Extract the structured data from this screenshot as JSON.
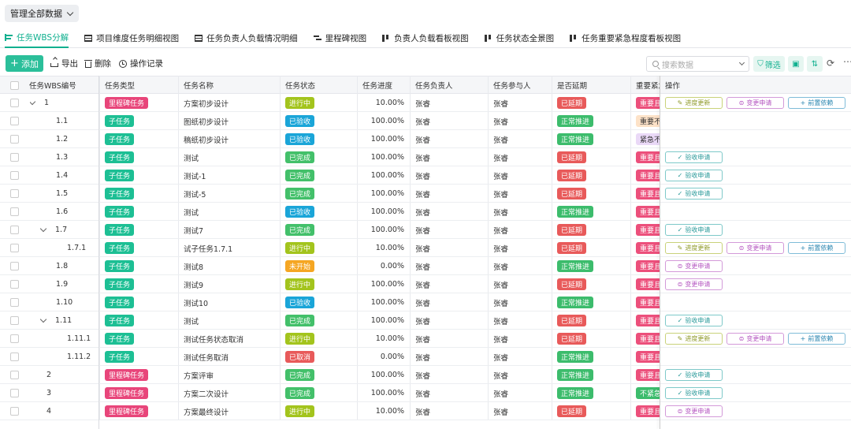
{
  "top_filter": {
    "label": "管理全部数据"
  },
  "tabs": [
    {
      "label": "任务WBS分解",
      "icon": "tree-icon",
      "active": true
    },
    {
      "label": "项目维度任务明细视图",
      "icon": "table-icon"
    },
    {
      "label": "任务负责人负载情况明细",
      "icon": "table-icon"
    },
    {
      "label": "里程碑视图",
      "icon": "gantt-icon"
    },
    {
      "label": "负责人负载看板视图",
      "icon": "kanban-icon"
    },
    {
      "label": "任务状态全景图",
      "icon": "kanban-icon"
    },
    {
      "label": "任务重要紧急程度看板视图",
      "icon": "kanban-icon"
    }
  ],
  "toolbar": {
    "add": "添加",
    "export": "导出",
    "delete": "删除",
    "log": "操作记录",
    "search_placeholder": "搜索数据",
    "filter": "筛选"
  },
  "columns": [
    "任务WBS编号",
    "任务类型",
    "任务名称",
    "任务状态",
    "任务进度",
    "任务负责人",
    "任务参与人",
    "是否延期",
    "重要紧急",
    "操作"
  ],
  "colors": {
    "accent": "#10b08f",
    "milestone": "#e8457a",
    "subtask": "#1dbf94",
    "accepted": "#1aa5d8",
    "in_progress": "#a3c41d",
    "done": "#43c06a",
    "not_started": "#f5a623",
    "cancelled": "#e85a5a",
    "delayed": "#e85a5a",
    "normal": "#3cbc6c",
    "important_urgent": "#ec4f7b"
  },
  "actions": {
    "progress": "进度更新",
    "change": "变更申请",
    "pre": "前置依赖",
    "accept": "验收申请"
  },
  "rows": [
    {
      "wbs": "1",
      "level": 0,
      "expand": true,
      "type": "里程碑任务",
      "name": "方案初步设计",
      "status": "进行中",
      "progress": "10.00%",
      "owner": "张睿",
      "participant": "张睿",
      "delay": "已延期",
      "priority": "重要且",
      "ops": [
        "progress",
        "change",
        "pre"
      ]
    },
    {
      "wbs": "1.1",
      "level": 1,
      "type": "子任务",
      "name": "图纸初步设计",
      "status": "已验收",
      "progress": "100.00%",
      "owner": "张睿",
      "participant": "张睿",
      "delay": "正常推进",
      "priority": "重要不",
      "ops": []
    },
    {
      "wbs": "1.2",
      "level": 1,
      "type": "子任务",
      "name": "稿纸初步设计",
      "status": "已验收",
      "progress": "100.00%",
      "owner": "张睿",
      "participant": "张睿",
      "delay": "正常推进",
      "priority": "紧急不",
      "ops": []
    },
    {
      "wbs": "1.3",
      "level": 1,
      "type": "子任务",
      "name": "测试",
      "status": "已完成",
      "progress": "100.00%",
      "owner": "张睿",
      "participant": "张睿",
      "delay": "已延期",
      "priority": "重要且",
      "ops": [
        "accept"
      ]
    },
    {
      "wbs": "1.4",
      "level": 1,
      "type": "子任务",
      "name": "测试-1",
      "status": "已完成",
      "progress": "100.00%",
      "owner": "张睿",
      "participant": "张睿",
      "delay": "已延期",
      "priority": "重要且",
      "ops": [
        "accept"
      ]
    },
    {
      "wbs": "1.5",
      "level": 1,
      "type": "子任务",
      "name": "测试-5",
      "status": "已完成",
      "progress": "100.00%",
      "owner": "张睿",
      "participant": "张睿",
      "delay": "已延期",
      "priority": "重要且",
      "ops": [
        "accept"
      ]
    },
    {
      "wbs": "1.6",
      "level": 1,
      "type": "子任务",
      "name": "测试",
      "status": "已验收",
      "progress": "100.00%",
      "owner": "张睿",
      "participant": "张睿",
      "delay": "正常推进",
      "priority": "重要且",
      "ops": []
    },
    {
      "wbs": "1.7",
      "level": 1,
      "expand": true,
      "type": "子任务",
      "name": "测试7",
      "status": "已完成",
      "progress": "100.00%",
      "owner": "张睿",
      "participant": "张睿",
      "delay": "已延期",
      "priority": "重要且",
      "ops": [
        "accept"
      ]
    },
    {
      "wbs": "1.7.1",
      "level": 2,
      "type": "子任务",
      "name": "试子任务1.7.1",
      "status": "进行中",
      "progress": "10.00%",
      "owner": "张睿",
      "participant": "张睿",
      "delay": "已延期",
      "priority": "重要且",
      "ops": [
        "progress",
        "change",
        "pre"
      ]
    },
    {
      "wbs": "1.8",
      "level": 1,
      "type": "子任务",
      "name": "测试8",
      "status": "未开始",
      "progress": "0.00%",
      "owner": "张睿",
      "participant": "张睿",
      "delay": "正常推进",
      "priority": "重要且",
      "ops": [
        "change"
      ]
    },
    {
      "wbs": "1.9",
      "level": 1,
      "type": "子任务",
      "name": "测试9",
      "status": "进行中",
      "progress": "100.00%",
      "owner": "张睿",
      "participant": "张睿",
      "delay": "已延期",
      "priority": "重要且",
      "ops": [
        "change"
      ]
    },
    {
      "wbs": "1.10",
      "level": 1,
      "type": "子任务",
      "name": "测试10",
      "status": "已验收",
      "progress": "100.00%",
      "owner": "张睿",
      "participant": "张睿",
      "delay": "正常推进",
      "priority": "重要且",
      "ops": []
    },
    {
      "wbs": "1.11",
      "level": 1,
      "expand": true,
      "type": "子任务",
      "name": "测试",
      "status": "已完成",
      "progress": "100.00%",
      "owner": "张睿",
      "participant": "张睿",
      "delay": "已延期",
      "priority": "重要且",
      "ops": [
        "accept"
      ]
    },
    {
      "wbs": "1.11.1",
      "level": 2,
      "type": "子任务",
      "name": "测试任务状态取消",
      "status": "进行中",
      "progress": "10.00%",
      "owner": "张睿",
      "participant": "张睿",
      "delay": "已延期",
      "priority": "重要且",
      "ops": [
        "progress",
        "change",
        "pre"
      ]
    },
    {
      "wbs": "1.11.2",
      "level": 2,
      "type": "子任务",
      "name": "测试任务取消",
      "status": "已取消",
      "progress": "0.00%",
      "owner": "张睿",
      "participant": "张睿",
      "delay": "正常推进",
      "priority": "重要且",
      "ops": []
    },
    {
      "wbs": "2",
      "level": 0,
      "type": "里程碑任务",
      "name": "方案评审",
      "status": "已完成",
      "progress": "100.00%",
      "owner": "张睿",
      "participant": "张睿",
      "delay": "正常推进",
      "priority": "重要且",
      "ops": [
        "accept"
      ]
    },
    {
      "wbs": "3",
      "level": 0,
      "type": "里程碑任务",
      "name": "方案二次设计",
      "status": "已完成",
      "progress": "100.00%",
      "owner": "张睿",
      "participant": "张睿",
      "delay": "正常推进",
      "priority": "不紧急",
      "ops": [
        "accept"
      ]
    },
    {
      "wbs": "4",
      "level": 0,
      "type": "里程碑任务",
      "name": "方案最终设计",
      "status": "进行中",
      "progress": "10.00%",
      "owner": "张睿",
      "participant": "张睿",
      "delay": "已延期",
      "priority": "重要且",
      "ops": [
        "change"
      ]
    }
  ]
}
